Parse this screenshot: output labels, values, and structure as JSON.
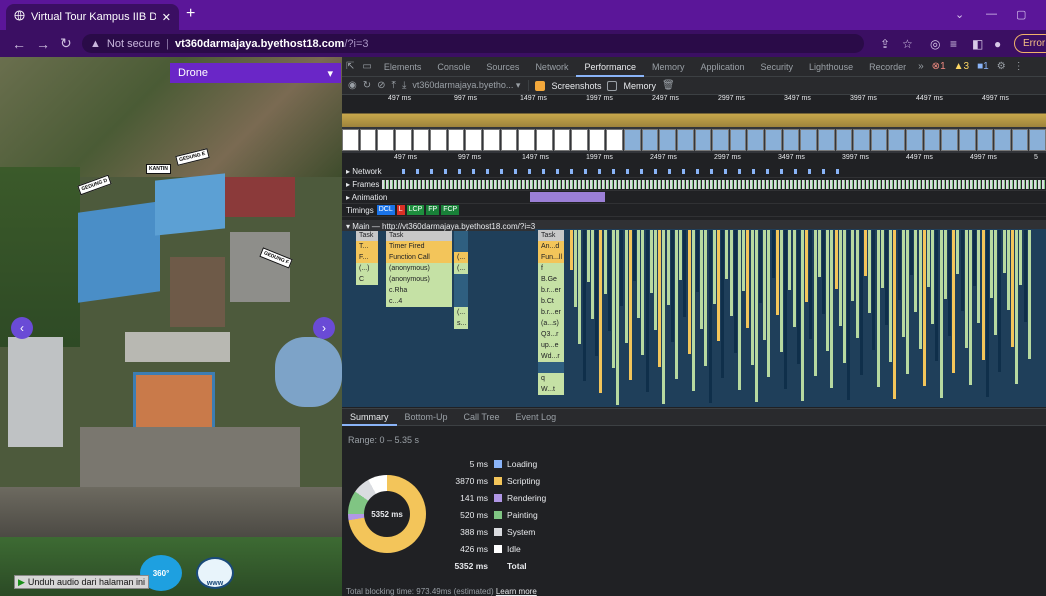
{
  "browser": {
    "tab_title": "Virtual Tour Kampus IIB Darmaja",
    "url_not_secure": "Not secure",
    "url_host": "vt360darmajaya.byethost18.com",
    "url_path": "/?i=3",
    "error_label": "Error"
  },
  "tour": {
    "dropdown_label": "Drone",
    "labels": [
      "GEDUNG D",
      "GEDUNG E",
      "KANTIN",
      "GEDUNG F"
    ],
    "audio_button": "Unduh audio dari halaman ini",
    "badge_360": "360°",
    "badge_www": "www"
  },
  "devtools": {
    "tabs": [
      "Elements",
      "Console",
      "Sources",
      "Network",
      "Performance",
      "Memory",
      "Application",
      "Security",
      "Lighthouse",
      "Recorder"
    ],
    "active_tab": "Performance",
    "status": {
      "errors": "1",
      "warnings": "3",
      "info": "1"
    },
    "url_select": "vt360darmajaya.byetho...",
    "screenshots_label": "Screenshots",
    "memory_label": "Memory",
    "overview_ticks": [
      "497 ms",
      "997 ms",
      "1497 ms",
      "1997 ms",
      "2497 ms",
      "2997 ms",
      "3497 ms",
      "3997 ms",
      "4497 ms",
      "4997 ms"
    ],
    "ruler_ticks": [
      "497 ms",
      "997 ms",
      "1497 ms",
      "1997 ms",
      "2497 ms",
      "2997 ms",
      "3497 ms",
      "3997 ms",
      "4497 ms",
      "4997 ms",
      "5"
    ],
    "tracks": {
      "network": "Network",
      "frames": "Frames",
      "animation": "Animation",
      "timings": "Timings",
      "timing_markers": [
        "DCL",
        "L",
        "LCP",
        "FP",
        "FCP"
      ],
      "main": "Main — http://vt360darmajaya.byethost18.com/?i=3"
    },
    "flame": {
      "col1": [
        "Task",
        "T...",
        "F...",
        "(...)",
        "C"
      ],
      "col2": [
        "Task",
        "Timer Fired",
        "Function Call",
        "(anonymous)",
        "(anonymous)",
        "c.Rha",
        "c...4"
      ],
      "col3": [
        "",
        "",
        "(...",
        "(...",
        "",
        "",
        "",
        "(...",
        "s..."
      ],
      "col4": [
        "Task",
        "An...d",
        "Fun...ll",
        "f",
        "B.Ge",
        "b.r...er",
        "b.Ct",
        "b.r...er",
        "(a...s)",
        "Q3...r",
        "up...e",
        "Wd...r",
        "",
        "q",
        "W...t"
      ]
    },
    "summary_tabs": [
      "Summary",
      "Bottom-Up",
      "Call Tree",
      "Event Log"
    ],
    "range": "Range: 0 – 5.35 s",
    "donut_center": "5352 ms",
    "breakdown": [
      {
        "name": "Loading",
        "value": "5 ms",
        "ms": 5,
        "color": "#8ab4f8"
      },
      {
        "name": "Scripting",
        "value": "3870 ms",
        "ms": 3870,
        "color": "#f3c55a"
      },
      {
        "name": "Rendering",
        "value": "141 ms",
        "ms": 141,
        "color": "#b197e6"
      },
      {
        "name": "Painting",
        "value": "520 ms",
        "ms": 520,
        "color": "#80c583"
      },
      {
        "name": "System",
        "value": "388 ms",
        "ms": 388,
        "color": "#dadce0"
      },
      {
        "name": "Idle",
        "value": "426 ms",
        "ms": 426,
        "color": "#ffffff"
      }
    ],
    "total_value": "5352 ms",
    "total_label": "Total",
    "blocking_text": "Total blocking time: 973.49ms (estimated)",
    "learn_more": "Learn more"
  }
}
